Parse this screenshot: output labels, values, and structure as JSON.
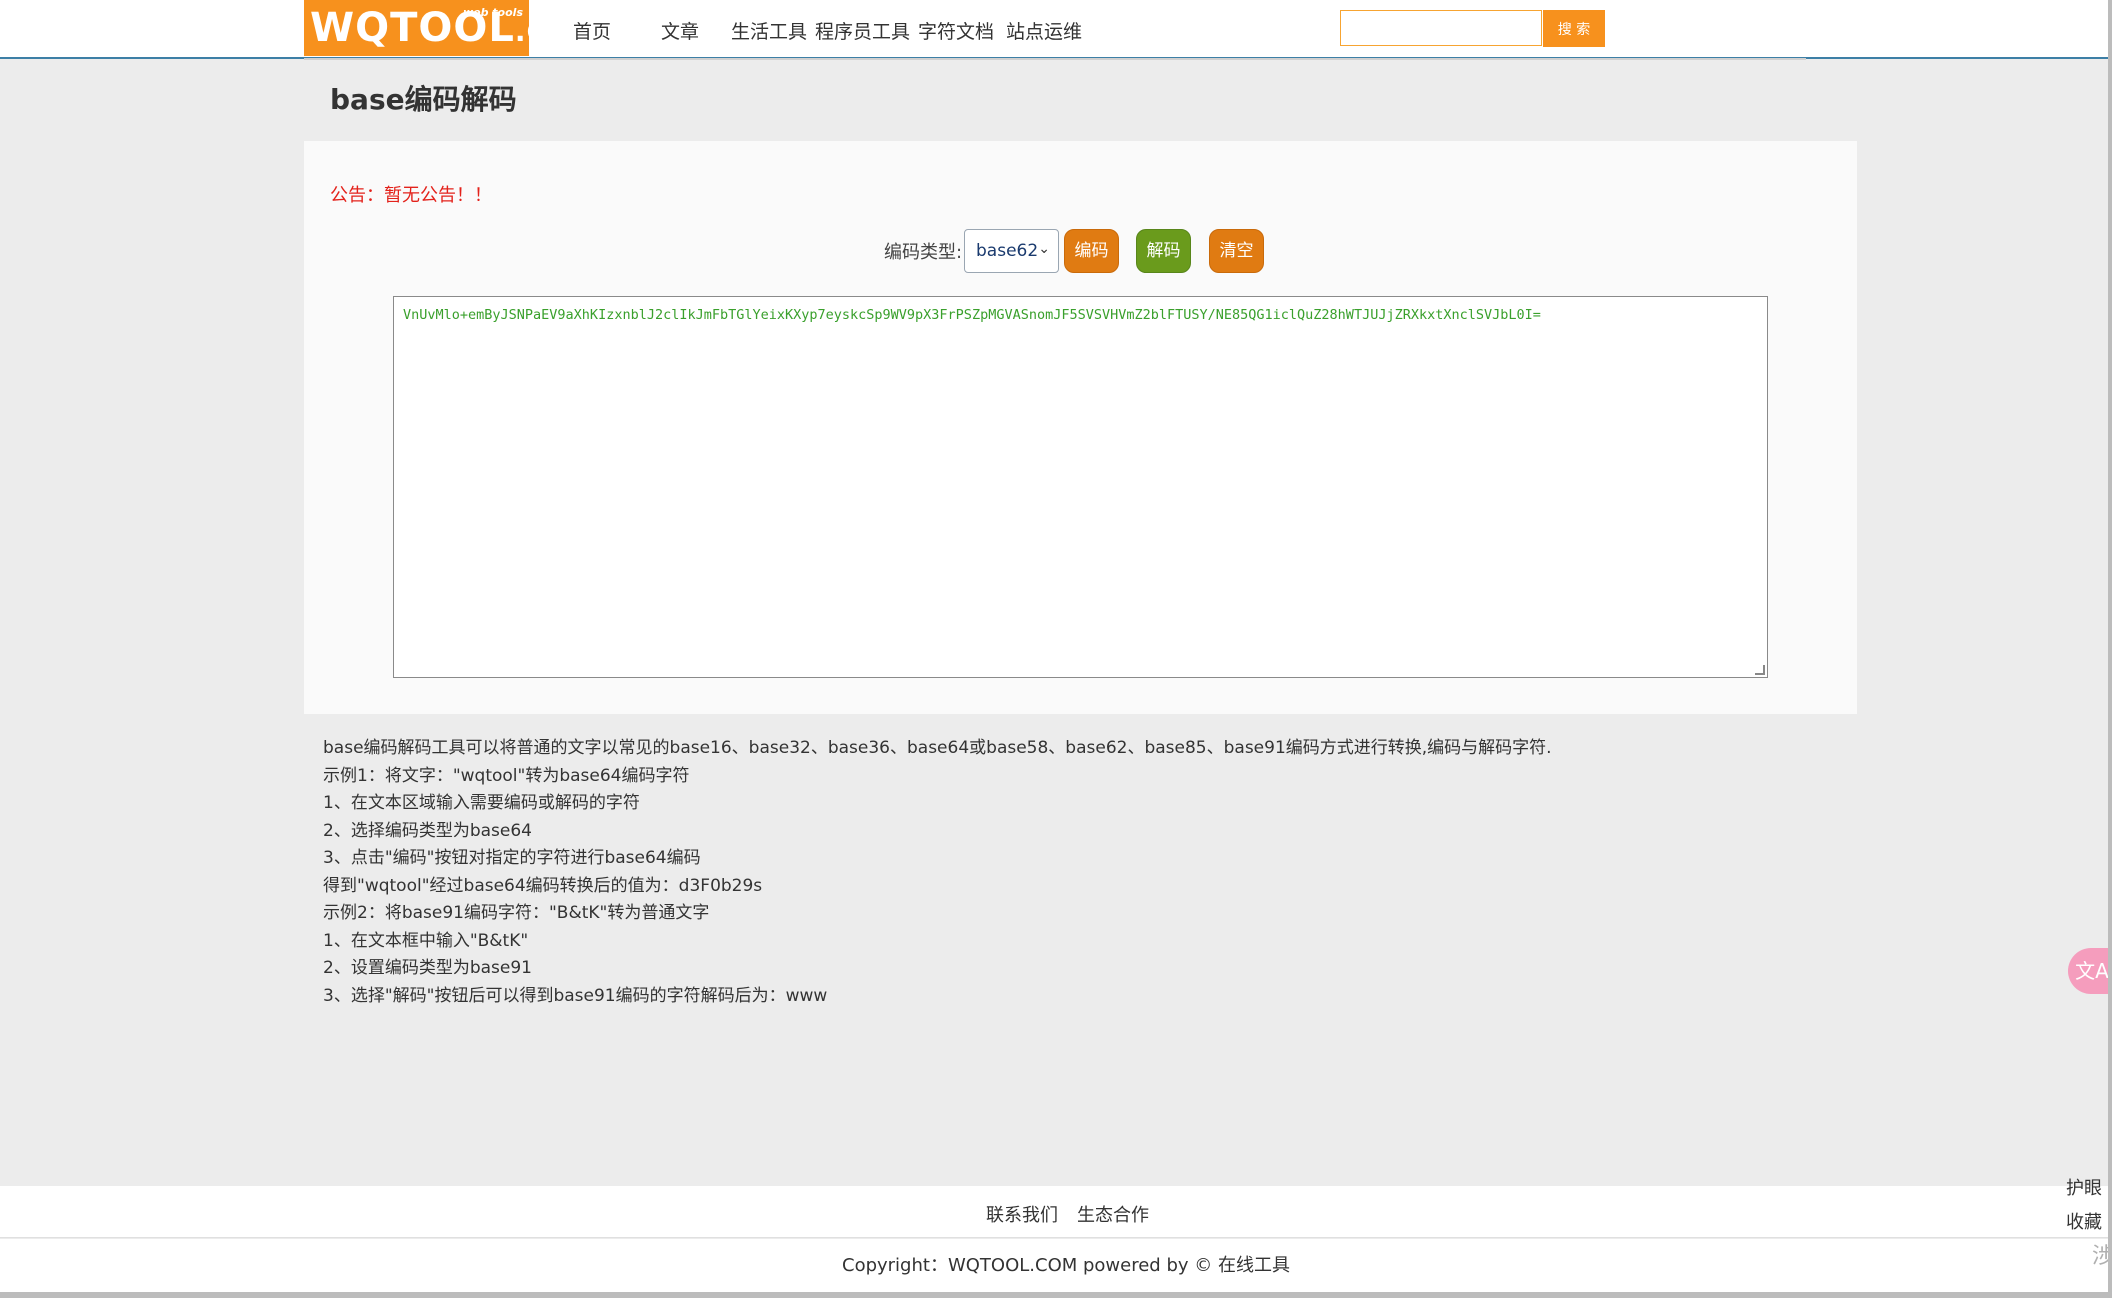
{
  "header": {
    "logo_main": "WQTOOL",
    "logo_dotcom": ".COM",
    "logo_sub": "web tools",
    "nav": [
      "首页",
      "文章",
      "生活工具",
      "程序员工具",
      "字符文档",
      "站点运维"
    ],
    "search_placeholder": "",
    "search_button": "搜 索"
  },
  "page": {
    "title": "base编码解码"
  },
  "panel": {
    "notice": "公告：暂无公告！！",
    "type_label": "编码类型:",
    "type_selected": "base62",
    "encode_button": "编码",
    "decode_button": "解码",
    "clear_button": "清空",
    "textarea_value": "VnUvMlo+emByJSNPaEV9aXhKIzxnblJ2clIkJmFbTGlYeixKXyp7eyskcSp9WV9pX3FrPSZpMGVASnomJF5SVSVHVmZ2blFTUSY/NE85QG1iclQuZ28hWTJUJjZRXkxtXnclSVJbL0I="
  },
  "description": [
    "base编码解码工具可以将普通的文字以常见的base16、base32、base36、base64或base58、base62、base85、base91编码方式进行转换,编码与解码字符.",
    "示例1：将文字：\"wqtool\"转为base64编码字符",
    "1、在文本区域输入需要编码或解码的字符",
    "2、选择编码类型为base64",
    "3、点击\"编码\"按钮对指定的字符进行base64编码",
    "得到\"wqtool\"经过base64编码转换后的值为：d3F0b29s",
    "示例2：将base91编码字符：\"B&tK\"转为普通文字",
    "1、在文本框中输入\"B&tK\"",
    "2、设置编码类型为base91",
    "3、选择\"解码\"按钮后可以得到base91编码的字符解码后为：www"
  ],
  "footer": {
    "contact": "联系我们",
    "cooperation": "生态合作",
    "copyright": "Copyright：WQTOOL.COM powered by © 在线工具"
  },
  "side": {
    "translate_icon": "文A",
    "eye_care": "护眼",
    "favorite": "收藏",
    "faded_text": "涉"
  },
  "colors": {
    "brand_orange": "#f7911d",
    "notice_red": "#e3221b",
    "decode_green": "#6a9b1c",
    "text_green": "#3aa02c"
  }
}
